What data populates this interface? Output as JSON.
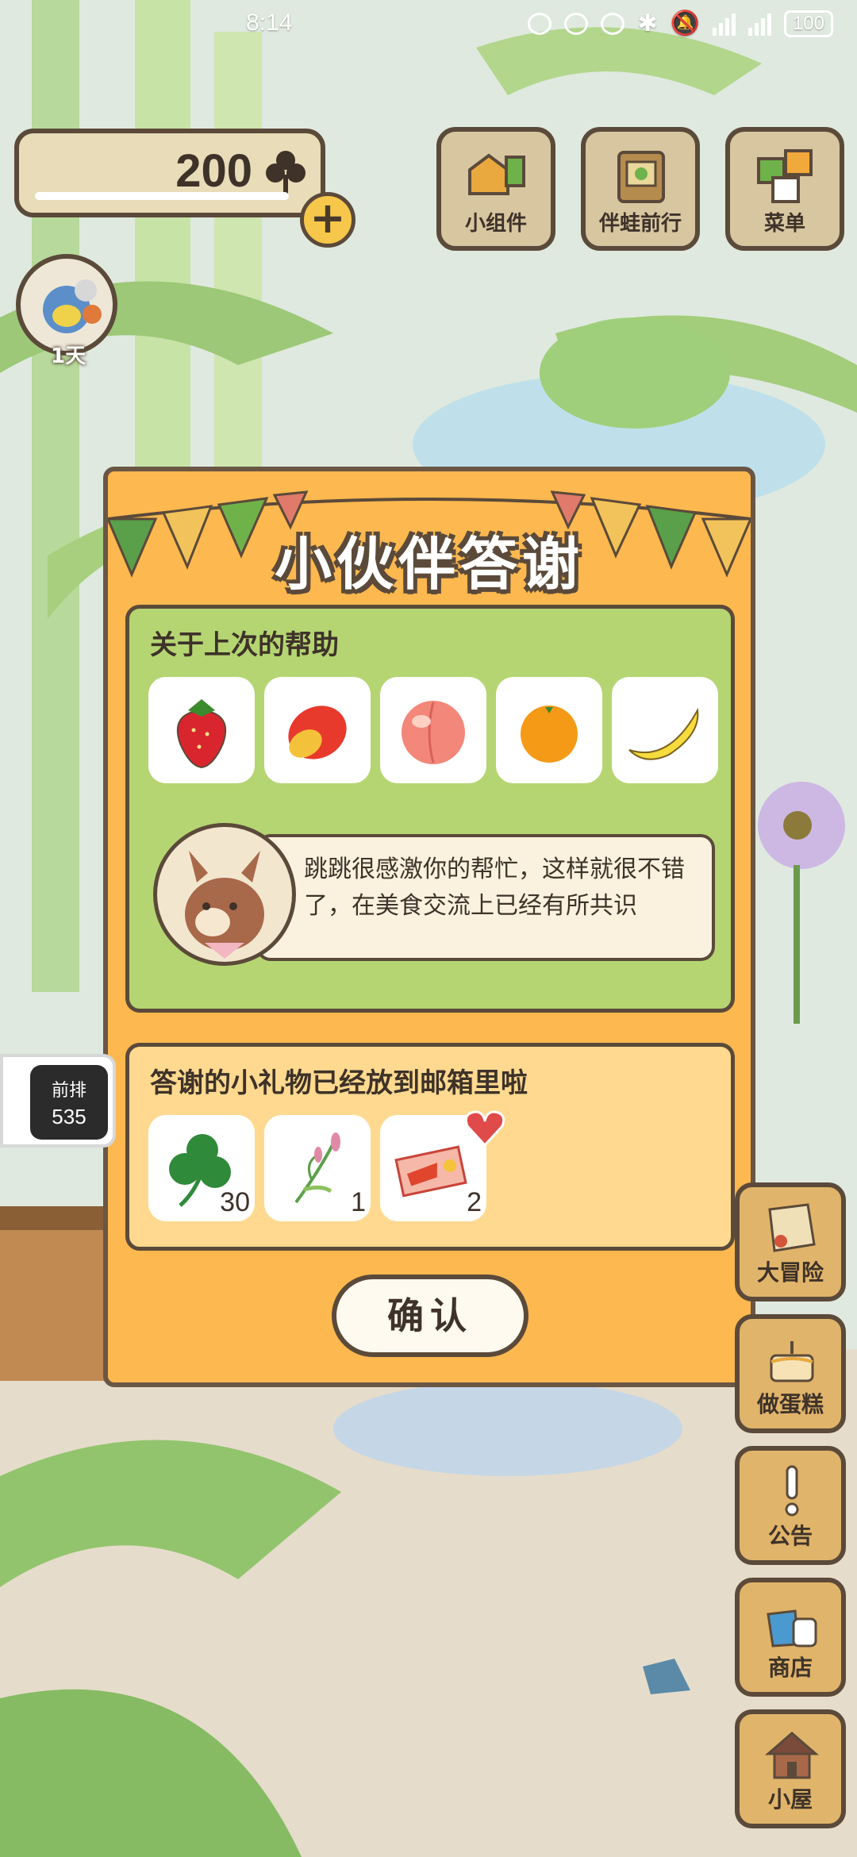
{
  "status_bar": {
    "time": "8:14",
    "battery": "100"
  },
  "currency": {
    "value": "200"
  },
  "top_buttons": [
    {
      "label": "小组件"
    },
    {
      "label": "伴蛙前行"
    },
    {
      "label": "菜单"
    }
  ],
  "avatar": {
    "day_label": "1天"
  },
  "dialog": {
    "title": "小伙伴答谢",
    "help_section": {
      "label": "关于上次的帮助",
      "items": [
        "strawberry",
        "mango",
        "peach",
        "orange",
        "banana"
      ],
      "message": "跳跳很感激你的帮忙，这样就很不错了，在美食交流上已经有所共识"
    },
    "gift_section": {
      "label": "答谢的小礼物已经放到邮箱里啦",
      "gifts": [
        {
          "icon": "clover-icon",
          "count": "30"
        },
        {
          "icon": "flower-sprig-icon",
          "count": "1"
        },
        {
          "icon": "ticket-icon",
          "count": "2"
        }
      ]
    },
    "confirm_label": "确认"
  },
  "rank_badge": {
    "line1": "前排",
    "line2": "535"
  },
  "side_buttons": [
    {
      "label": "大冒险"
    },
    {
      "label": "做蛋糕"
    },
    {
      "label": "公告"
    },
    {
      "label": "商店"
    },
    {
      "label": "小屋"
    }
  ],
  "colors": {
    "dialog_bg": "#fdb84f",
    "panel_green": "#b5d572",
    "panel_yellow": "#fed98f",
    "outline": "#5b4a3a"
  }
}
